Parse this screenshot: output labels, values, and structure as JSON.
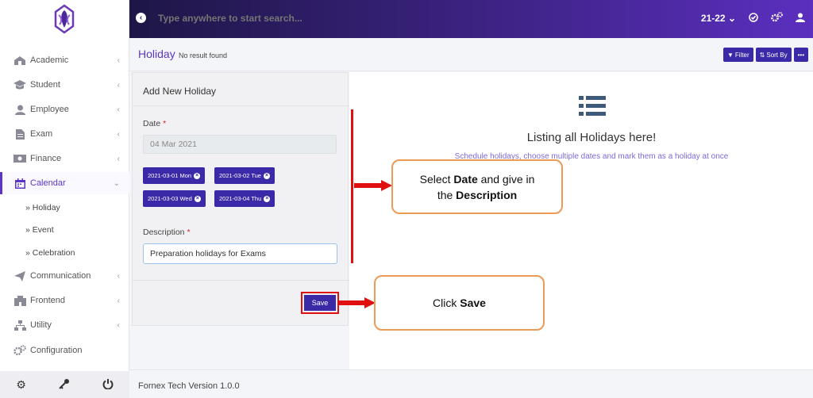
{
  "topbar": {
    "search_placeholder": "Type anywhere to start search...",
    "session": "21-22"
  },
  "sidebar": {
    "items": [
      {
        "label": "Academic",
        "icon": "school-icon"
      },
      {
        "label": "Student",
        "icon": "graduation-cap-icon"
      },
      {
        "label": "Employee",
        "icon": "user-icon"
      },
      {
        "label": "Exam",
        "icon": "document-icon"
      },
      {
        "label": "Finance",
        "icon": "money-icon"
      },
      {
        "label": "Calendar",
        "icon": "calendar-icon"
      },
      {
        "label": "Communication",
        "icon": "paper-plane-icon"
      },
      {
        "label": "Frontend",
        "icon": "building-icon"
      },
      {
        "label": "Utility",
        "icon": "sitemap-icon"
      },
      {
        "label": "Configuration",
        "icon": "cogs-icon"
      }
    ],
    "calendar_sub": [
      "Holiday",
      "Event",
      "Celebration"
    ]
  },
  "page": {
    "title": "Holiday",
    "subtitle": "No result found",
    "filter_label": "Filter",
    "sort_label": "Sort By",
    "more_label": "•••"
  },
  "form": {
    "title": "Add New Holiday",
    "date_label": "Date",
    "date_value": "04 Mar 2021",
    "chips": [
      "2021-03-01 Mon",
      "2021-03-02 Tue",
      "2021-03-03 Wed",
      "2021-03-04 Thu"
    ],
    "description_label": "Description",
    "description_value": "Preparation holidays for Exams",
    "save_label": "Save"
  },
  "empty_state": {
    "title": "Listing all Holidays here!",
    "subtitle": "Schedule holidays, choose multiple dates and mark them as a holiday at once"
  },
  "callouts": {
    "date_desc": {
      "before": "Select ",
      "b1": "Date",
      "mid": " and give in",
      "the": "the ",
      "b2": "Description"
    },
    "save": {
      "before": "Click ",
      "b1": "Save"
    }
  },
  "footer": {
    "version": "Fornex Tech Version 1.0.0"
  },
  "colors": {
    "accent": "#5b35c4",
    "button": "#3b2aa8",
    "highlight": "#e01010",
    "callout_border": "#ec9b57"
  }
}
